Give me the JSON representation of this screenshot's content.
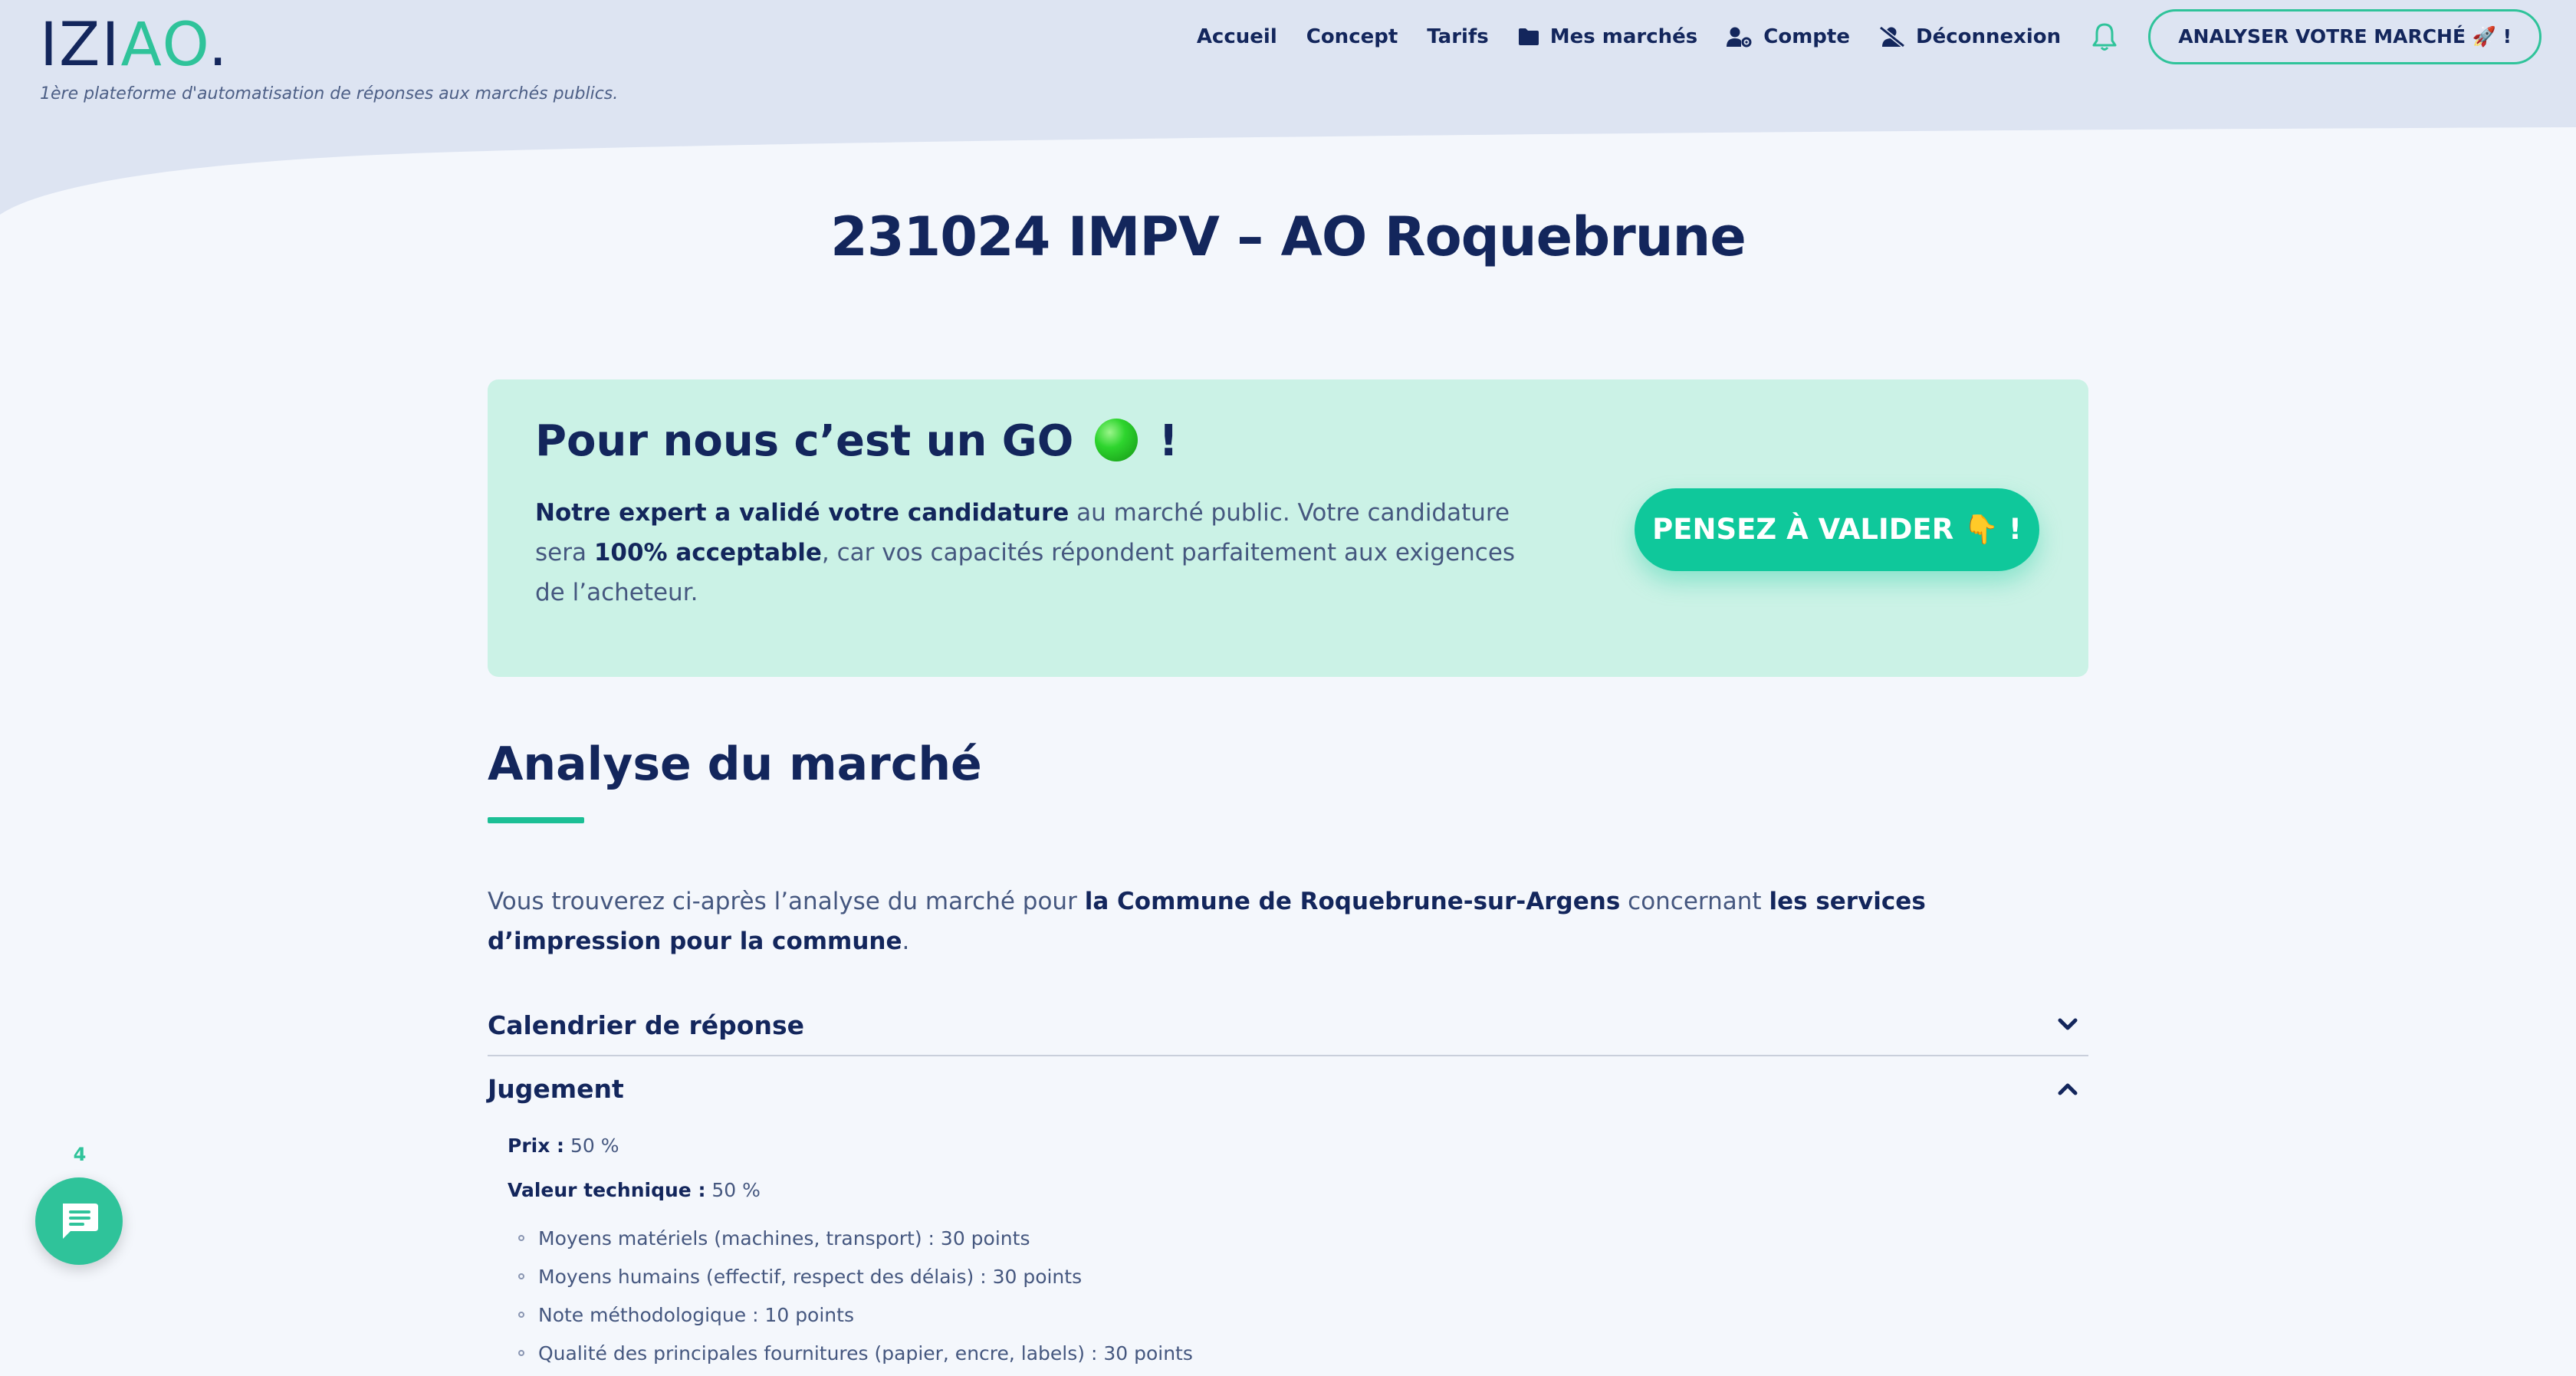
{
  "header": {
    "logo": {
      "part1": "IZI",
      "part2": "AO",
      "part3": "."
    },
    "tagline": "1ère plateforme d'automatisation de réponses aux marchés publics.",
    "nav": {
      "accueil": "Accueil",
      "concept": "Concept",
      "tarifs": "Tarifs",
      "mes_marches": "Mes marchés",
      "compte": "Compte",
      "deconnexion": "Déconnexion",
      "cta": "ANALYSER VOTRE MARCHÉ 🚀 !"
    }
  },
  "page": {
    "title": "231024 IMPV – AO Roquebrune"
  },
  "go_card": {
    "title_before": "Pour nous c’est un GO",
    "title_after": "!",
    "text_bold1": "Notre expert a validé votre candidature",
    "text_part1": " au marché public. Votre candidature sera ",
    "text_bold2": "100% acceptable",
    "text_part2": ", car vos capacités répondent parfaitement aux exigences de l’acheteur.",
    "button": "PENSEZ À VALIDER 👇 !"
  },
  "analyse": {
    "title": "Analyse du marché",
    "intro_part1": "Vous trouverez ci-après l’analyse du marché pour ",
    "intro_bold1": "la Commune de Roquebrune-sur-Argens",
    "intro_part2": " concernant ",
    "intro_bold2": "les services d’impression pour la commune",
    "intro_part3": "."
  },
  "accordion": [
    {
      "label": "Calendrier de réponse",
      "state": "collapsed"
    },
    {
      "label": "Jugement",
      "state": "expanded"
    }
  ],
  "jugement": {
    "prix_label": "Prix :",
    "prix_value": " 50 %",
    "technique_label": "Valeur technique :",
    "technique_value": " 50 %",
    "sub_criteria": [
      "Moyens matériels (machines, transport) : 30 points",
      "Moyens humains (effectif, respect des délais) : 30 points",
      "Note méthodologique : 10 points",
      "Qualité des principales fournitures (papier, encre, labels) : 30 points"
    ]
  },
  "chat": {
    "count": "4"
  },
  "colors": {
    "navy": "#13265c",
    "green": "#2fc39a",
    "button_green": "#0fc89b",
    "card_bg": "#cbf2e6",
    "header_bg": "#dde4f2",
    "page_bg": "#f4f7fc"
  },
  "icons": [
    "folder-icon",
    "user-gear-icon",
    "user-slash-icon",
    "bell-icon",
    "chevron-down-icon",
    "chevron-up-icon",
    "chat-icon"
  ]
}
